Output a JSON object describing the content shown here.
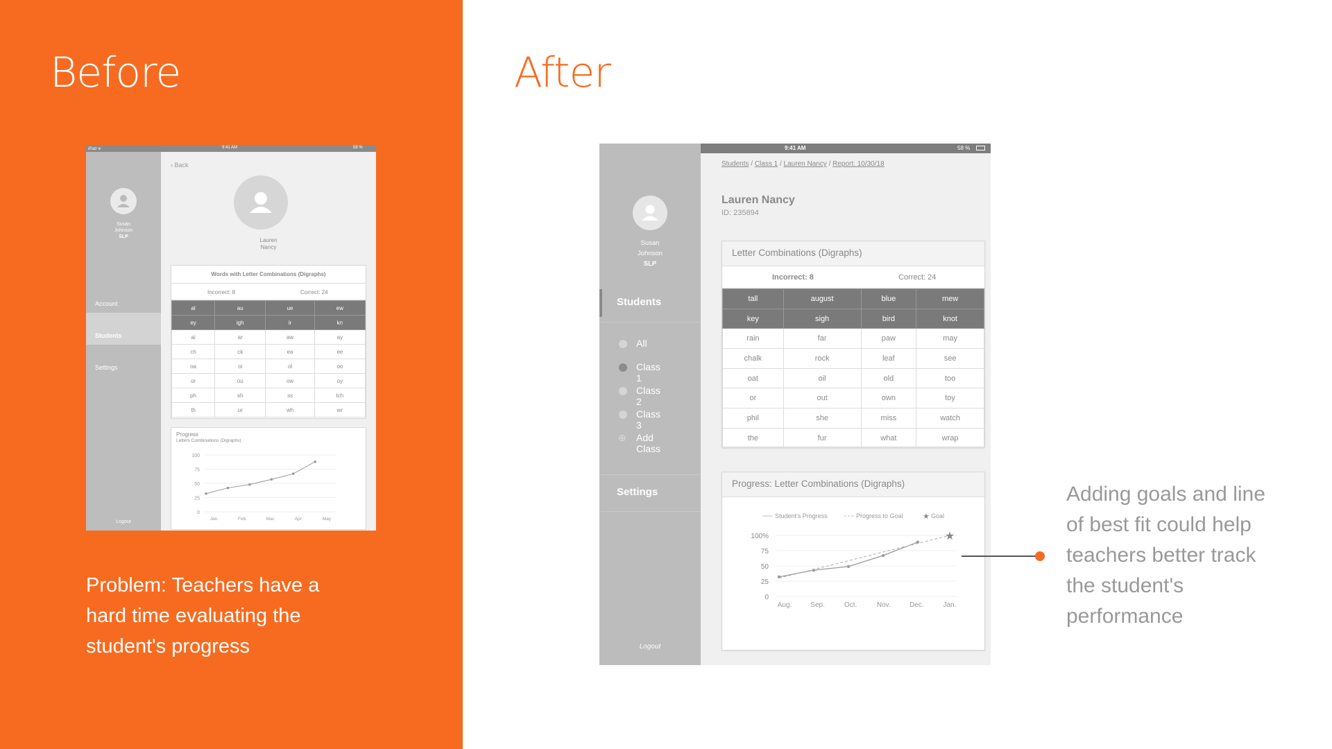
{
  "before": {
    "title": "Before",
    "problem_text": "Problem: Teachers have a hard time evaluating the student's progress",
    "mockup": {
      "status": {
        "left": "iPad ᯤ",
        "time": "9:41 AM",
        "battery": "58 %"
      },
      "user": {
        "first": "Susan",
        "last": "Johnson",
        "role": "SLP"
      },
      "nav": [
        "Account",
        "Students",
        "Settings"
      ],
      "logout": "Logout",
      "back": "Back",
      "student": {
        "first": "Lauren",
        "last": "Nancy"
      },
      "table_title": "Words with Letter Combinations (Digraphs)",
      "incorrect": "Incorrect: 8",
      "correct": "Correct: 24",
      "rows": [
        [
          "al",
          "au",
          "ue",
          "ew"
        ],
        [
          "ey",
          "igh",
          "ir",
          "kn"
        ],
        [
          "ai",
          "ar",
          "aw",
          "ay"
        ],
        [
          "ch",
          "ck",
          "ea",
          "ee"
        ],
        [
          "oa",
          "oi",
          "ol",
          "oo"
        ],
        [
          "or",
          "ou",
          "ow",
          "oy"
        ],
        [
          "ph",
          "sh",
          "ss",
          "tch"
        ],
        [
          "th",
          "ur",
          "wh",
          "wr"
        ]
      ],
      "progress_title": "Progress",
      "progress_subtitle": "Letters Combinations (Digraphs)",
      "chart_data": {
        "type": "line",
        "categories": [
          "Jan.",
          "Feb.",
          "Mar.",
          "Apr.",
          "May"
        ],
        "yticks": [
          100,
          75,
          50,
          25,
          0
        ],
        "ylim": [
          0,
          100
        ],
        "series": [
          {
            "values": [
              32,
              42,
              48,
              57,
              67,
              88
            ]
          }
        ]
      }
    }
  },
  "after": {
    "title": "After",
    "note": "Adding goals and line of best fit could help teachers better track the student's performance",
    "mockup": {
      "status": {
        "time": "9:41 AM",
        "battery": "58 %"
      },
      "user": {
        "first": "Susan",
        "last": "Johnson",
        "role": "SLP"
      },
      "nav_students": "Students",
      "classes": [
        "All",
        "Class 1",
        "Class 2",
        "Class 3"
      ],
      "add_class": "Add Class",
      "nav_settings": "Settings",
      "logout": "Logout",
      "breadcrumb": [
        "Students",
        "Class 1",
        "Lauren Nancy",
        "Report: 10/30/18"
      ],
      "student_name": "Lauren Nancy",
      "student_id": "ID: 235894",
      "table_title": "Letter Combinations (Digraphs)",
      "incorrect": "Incorrect: 8",
      "correct": "Correct: 24",
      "rows": [
        [
          "tall",
          "august",
          "blue",
          "mew"
        ],
        [
          "key",
          "sigh",
          "bird",
          "knot"
        ],
        [
          "rain",
          "far",
          "paw",
          "may"
        ],
        [
          "chalk",
          "rock",
          "leaf",
          "see"
        ],
        [
          "oat",
          "oil",
          "old",
          "too"
        ],
        [
          "or",
          "out",
          "own",
          "toy"
        ],
        [
          "phil",
          "she",
          "miss",
          "watch"
        ],
        [
          "the",
          "fur",
          "what",
          "wrap"
        ]
      ],
      "progress_title": "Progress: Letter Combinations (Digraphs)",
      "legend": {
        "student": "Student's Progress",
        "goal_line": "Progress to Goal",
        "goal": "Goal"
      },
      "chart_data": {
        "type": "line",
        "categories": [
          "Aug.",
          "Sep.",
          "Oct.",
          "Nov.",
          "Dec.",
          "Jan."
        ],
        "yticks": [
          "100%",
          "75",
          "50",
          "25",
          "0"
        ],
        "ylim": [
          0,
          100
        ],
        "series": [
          {
            "name": "Student's Progress",
            "values": [
              32,
              43,
              49,
              67,
              89
            ]
          },
          {
            "name": "Progress to Goal",
            "values": [
              30,
              100
            ]
          },
          {
            "name": "Goal",
            "values": [
              100
            ]
          }
        ]
      },
      "colors": {
        "accent": "#F76B20",
        "sidebar": "#BCBCBC",
        "header_row": "#7A7A7A"
      }
    }
  }
}
